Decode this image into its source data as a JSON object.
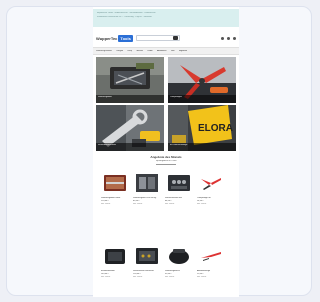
{
  "banner": {
    "line1": "Impressum · AGB · Widerrufsrecht · Versandkosten · Datenschutz",
    "line2": "Kostenloser Versand ab 99 € · Rechnung · PayPal · Vorkasse"
  },
  "header": {
    "logo_main": "WupperTec",
    "logo_badge": "Tools",
    "search_placeholder": "Suche..."
  },
  "nav": {
    "items": [
      "Werkzeug-Marken",
      "Zangen",
      "Crimp",
      "Messen",
      "Kabel",
      "Abisolieren",
      "Sets",
      "Angebote"
    ]
  },
  "heroes": [
    {
      "caption": "Werkzeugkoffer"
    },
    {
      "caption": "Crimpzangen"
    },
    {
      "caption": "Schraubenschlüssel"
    },
    {
      "caption": "ELORA Werkzeuge"
    }
  ],
  "section": {
    "title": "Angebote des Monats",
    "subtitle": "Top-Angebote für Profis"
  },
  "products": [
    {
      "name": "Werkzeugkoffer Basic",
      "price": "129,00 €",
      "note": "inkl. MwSt."
    },
    {
      "name": "Werkzeugsatz Profi 34-tlg.",
      "price": "89,90 €",
      "note": "inkl. MwSt."
    },
    {
      "name": "Steckschlüssel-Set",
      "price": "64,50 €",
      "note": "inkl. MwSt."
    },
    {
      "name": "Crimpzange rot",
      "price": "24,90 €",
      "note": "inkl. MwSt."
    },
    {
      "name": "Elektronikkoffer",
      "price": "149,00 €",
      "note": "inkl. MwSt."
    },
    {
      "name": "Servicekoffer Mechanik",
      "price": "199,00 €",
      "note": "inkl. MwSt."
    },
    {
      "name": "Werkzeugtasche",
      "price": "39,90 €",
      "note": "inkl. MwSt."
    },
    {
      "name": "Abisolierzange",
      "price": "19,90 €",
      "note": "inkl. MwSt."
    }
  ]
}
